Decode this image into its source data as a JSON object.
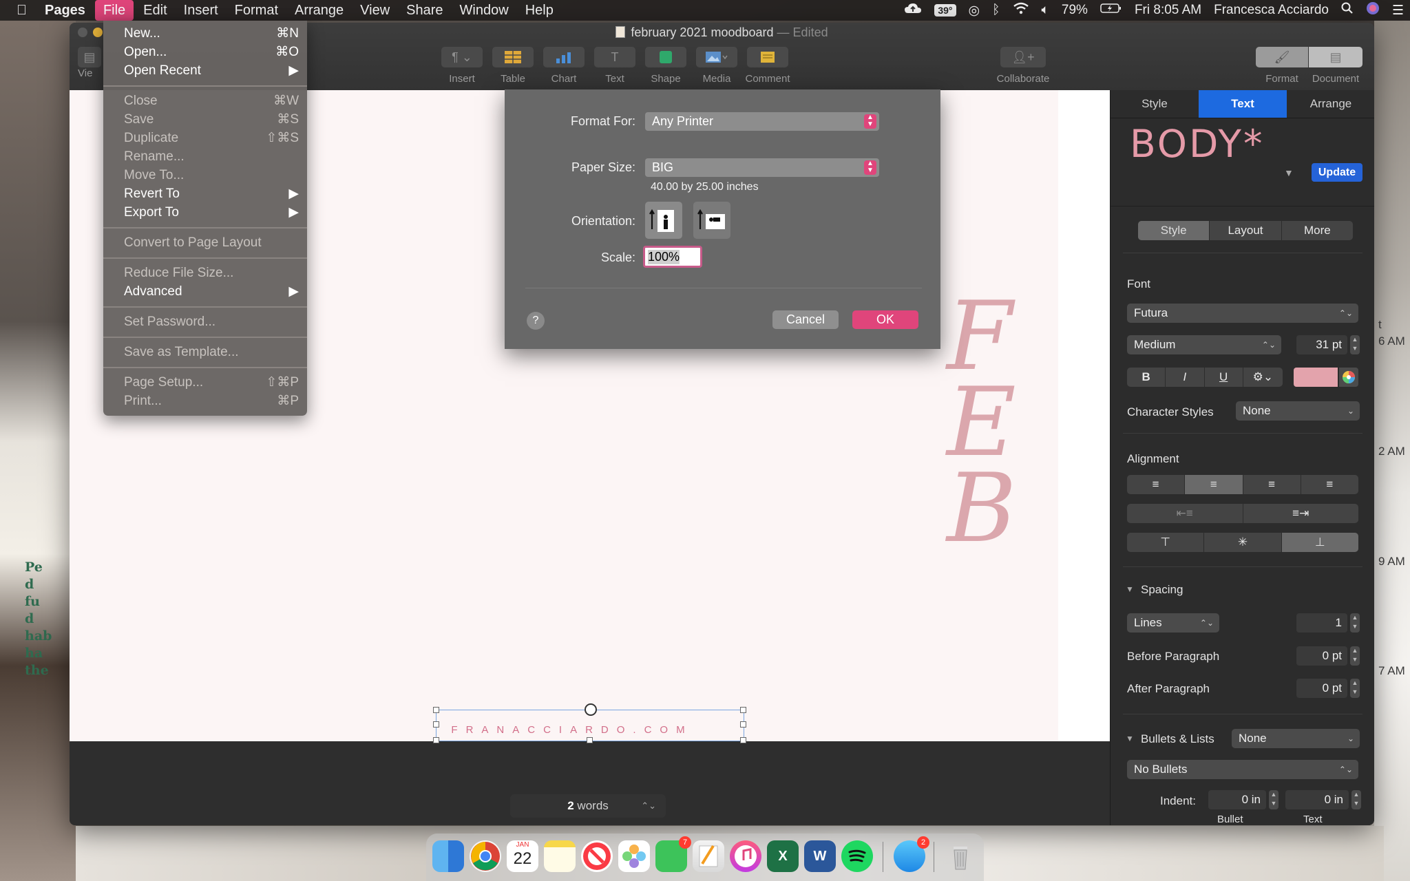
{
  "menubar": {
    "app": "Pages",
    "items": [
      "File",
      "Edit",
      "Insert",
      "Format",
      "Arrange",
      "View",
      "Share",
      "Window",
      "Help"
    ],
    "temperature": "39°",
    "battery": "79%",
    "datetime": "Fri 8:05 AM",
    "user": "Francesca Acciardo"
  },
  "window": {
    "title": "february 2021 moodboard",
    "edited": "— Edited",
    "toolbar_left_label": "Vie",
    "toolbar": [
      "Insert",
      "Table",
      "Chart",
      "Text",
      "Shape",
      "Media",
      "Comment"
    ],
    "collaborate": "Collaborate",
    "format": "Format",
    "document": "Document"
  },
  "file_menu": {
    "items": [
      {
        "label": "New...",
        "shortcut": "⌘N",
        "enabled": true
      },
      {
        "label": "Open...",
        "shortcut": "⌘O",
        "enabled": true
      },
      {
        "label": "Open Recent",
        "shortcut": "▶",
        "enabled": true
      },
      {
        "label": "Close",
        "shortcut": "⌘W",
        "enabled": false
      },
      {
        "label": "Save",
        "shortcut": "⌘S",
        "enabled": false
      },
      {
        "label": "Duplicate",
        "shortcut": "⇧⌘S",
        "enabled": false
      },
      {
        "label": "Rename...",
        "shortcut": "",
        "enabled": false
      },
      {
        "label": "Move To...",
        "shortcut": "",
        "enabled": false
      },
      {
        "label": "Revert To",
        "shortcut": "▶",
        "enabled": true
      },
      {
        "label": "Export To",
        "shortcut": "▶",
        "enabled": true
      },
      {
        "label": "Convert to Page Layout",
        "shortcut": "",
        "enabled": false
      },
      {
        "label": "Reduce File Size...",
        "shortcut": "",
        "enabled": false
      },
      {
        "label": "Advanced",
        "shortcut": "▶",
        "enabled": true
      },
      {
        "label": "Set Password...",
        "shortcut": "",
        "enabled": false
      },
      {
        "label": "Save as Template...",
        "shortcut": "",
        "enabled": false
      },
      {
        "label": "Page Setup...",
        "shortcut": "⇧⌘P",
        "enabled": false
      },
      {
        "label": "Print...",
        "shortcut": "⌘P",
        "enabled": false
      }
    ]
  },
  "dialog": {
    "format_for_label": "Format For:",
    "format_for_value": "Any Printer",
    "paper_size_label": "Paper Size:",
    "paper_size_value": "BIG",
    "paper_dims": "40.00 by 25.00 inches",
    "orientation_label": "Orientation:",
    "scale_label": "Scale:",
    "scale_value": "100%",
    "help": "?",
    "cancel": "Cancel",
    "ok": "OK"
  },
  "document": {
    "feb_letters": [
      "F",
      "E",
      "B"
    ],
    "footer_text": "FRANACCIARDO.COM",
    "word_count_number": "2",
    "word_count_label": "words"
  },
  "inspector": {
    "tabs": [
      "Style",
      "Text",
      "Arrange"
    ],
    "active_tab": "Text",
    "paragraph_style": "BODY*",
    "update": "Update",
    "subtabs": [
      "Style",
      "Layout",
      "More"
    ],
    "font_label": "Font",
    "font_family": "Futura",
    "font_typeface": "Medium",
    "font_size": "31 pt",
    "bold": "B",
    "italic": "I",
    "underline": "U",
    "text_color": "#e3a3ac",
    "character_styles_label": "Character Styles",
    "character_styles_value": "None",
    "alignment_label": "Alignment",
    "spacing_label": "Spacing",
    "spacing_mode": "Lines",
    "spacing_value": "1",
    "before_paragraph_label": "Before Paragraph",
    "before_paragraph_value": "0 pt",
    "after_paragraph_label": "After Paragraph",
    "after_paragraph_value": "0 pt",
    "bullets_label": "Bullets & Lists",
    "bullets_value": "None",
    "bullets_style": "No Bullets",
    "indent_label": "Indent:",
    "indent_bullet": "0 in",
    "indent_text": "0 in",
    "bullet_caption": "Bullet",
    "text_caption": "Text"
  },
  "desktop": {
    "left_text": "Pe\nd\nfu\nd\nhab\nha\nthe",
    "right_times": [
      "t",
      "6 AM",
      "2 AM",
      "9 AM",
      "7 AM"
    ]
  },
  "dock": {
    "badges": {
      "facetime": "7",
      "messages": "2"
    },
    "calendar_month": "JAN",
    "calendar_day": "22"
  },
  "colors": {
    "accent_pink": "#e0457b",
    "selection_blue": "#1d6ae0",
    "feb_pink": "#dba7ad"
  }
}
